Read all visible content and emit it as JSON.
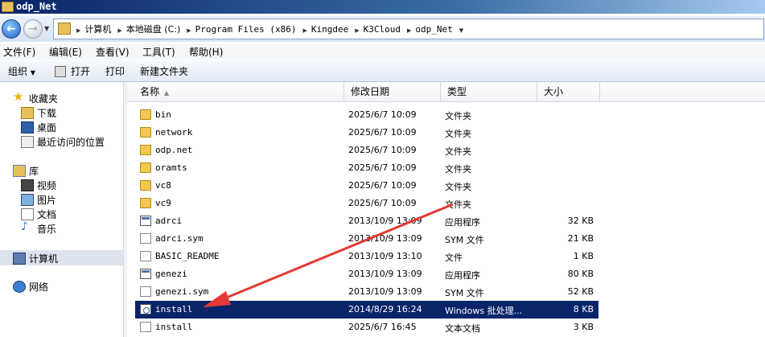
{
  "window": {
    "title": "odp_Net"
  },
  "address": {
    "crumbs": [
      {
        "label": "计算机",
        "mono": false
      },
      {
        "label": "本地磁盘 (C:)",
        "mono": false
      },
      {
        "label": "Program Files (x86)",
        "mono": true
      },
      {
        "label": "Kingdee",
        "mono": true
      },
      {
        "label": "K3Cloud",
        "mono": true
      },
      {
        "label": "odp_Net",
        "mono": true
      }
    ]
  },
  "menu": {
    "file": "文件(F)",
    "edit": "编辑(E)",
    "view": "查看(V)",
    "tools": "工具(T)",
    "help": "帮助(H)"
  },
  "toolbar": {
    "organize": "组织",
    "open": "打开",
    "print": "打印",
    "new_folder": "新建文件夹"
  },
  "sidebar": {
    "favorites": "收藏夹",
    "downloads": "下载",
    "desktop": "桌面",
    "recent": "最近访问的位置",
    "libraries": "库",
    "videos": "视频",
    "pictures": "图片",
    "documents": "文档",
    "music": "音乐",
    "computer": "计算机",
    "network": "网络"
  },
  "columns": {
    "name": "名称",
    "date": "修改日期",
    "type": "类型",
    "size": "大小"
  },
  "files": [
    {
      "name": "bin",
      "date": "2025/6/7 10:09",
      "type": "文件夹",
      "size": "",
      "icon": "folder"
    },
    {
      "name": "network",
      "date": "2025/6/7 10:09",
      "type": "文件夹",
      "size": "",
      "icon": "folder"
    },
    {
      "name": "odp.net",
      "date": "2025/6/7 10:09",
      "type": "文件夹",
      "size": "",
      "icon": "folder"
    },
    {
      "name": "oramts",
      "date": "2025/6/7 10:09",
      "type": "文件夹",
      "size": "",
      "icon": "folder"
    },
    {
      "name": "vc8",
      "date": "2025/6/7 10:09",
      "type": "文件夹",
      "size": "",
      "icon": "folder"
    },
    {
      "name": "vc9",
      "date": "2025/6/7 10:09",
      "type": "文件夹",
      "size": "",
      "icon": "folder"
    },
    {
      "name": "adrci",
      "date": "2013/10/9 13:09",
      "type": "应用程序",
      "size": "32 KB",
      "icon": "app"
    },
    {
      "name": "adrci.sym",
      "date": "2013/10/9 13:09",
      "type": "SYM 文件",
      "size": "21 KB",
      "icon": "doc"
    },
    {
      "name": "BASIC_README",
      "date": "2013/10/9 13:10",
      "type": "文件",
      "size": "1 KB",
      "icon": "doc"
    },
    {
      "name": "genezi",
      "date": "2013/10/9 13:09",
      "type": "应用程序",
      "size": "80 KB",
      "icon": "app"
    },
    {
      "name": "genezi.sym",
      "date": "2013/10/9 13:09",
      "type": "SYM 文件",
      "size": "52 KB",
      "icon": "doc"
    },
    {
      "name": "install",
      "date": "2014/8/29 16:24",
      "type": "Windows 批处理...",
      "size": "8 KB",
      "icon": "bat",
      "selected": true
    },
    {
      "name": "install",
      "date": "2025/6/7 16:45",
      "type": "文本文档",
      "size": "3 KB",
      "icon": "doc"
    }
  ],
  "colors": {
    "selection": "#0a246a",
    "annotation_arrow": "#e53935"
  }
}
